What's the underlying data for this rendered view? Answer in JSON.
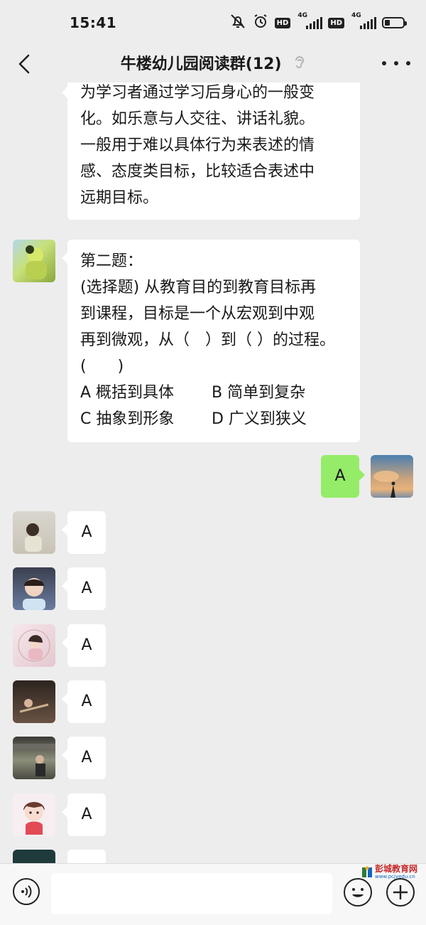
{
  "status_bar": {
    "time": "15:41",
    "hd1": "HD",
    "net1": "4G",
    "hd2": "HD",
    "net2": "4G",
    "battery_level": 0.3
  },
  "header": {
    "title": "牛楼幼儿园阅读群(12)"
  },
  "messages": [
    {
      "side": "left",
      "lines": [
        "为学习者通过学习后身心的一般变",
        "化。如乐意与人交往、讲话礼貌。",
        "一般用于难以具体行为来表述的情",
        "感、态度类目标，比较适合表述中",
        "远期目标。"
      ]
    },
    {
      "side": "left",
      "lines": [
        "第二题：",
        "(选择题) 从教育目的到教育目标再",
        "到课程，目标是一个从宏观到中观",
        "再到微观，从（　）到（ ）的过程。",
        "(　　)"
      ],
      "options": [
        "A 概括到具体",
        "B 简单到复杂",
        "C 抽象到形象",
        "D 广义到狭义"
      ]
    },
    {
      "side": "right",
      "text": "A"
    },
    {
      "side": "left",
      "text": "A"
    },
    {
      "side": "left",
      "text": "A"
    },
    {
      "side": "left",
      "text": "A"
    },
    {
      "side": "left",
      "text": "A"
    },
    {
      "side": "left",
      "text": "A"
    },
    {
      "side": "left",
      "text": "A"
    }
  ],
  "watermark": {
    "name": "彭城教育网",
    "url": "www.pcjyedu.cn"
  },
  "icons": {
    "back": "chevron-left-icon",
    "ear": "ear-icon",
    "more": "more-icon",
    "voice": "voice-icon",
    "emoji": "emoji-icon",
    "plus": "plus-icon"
  }
}
